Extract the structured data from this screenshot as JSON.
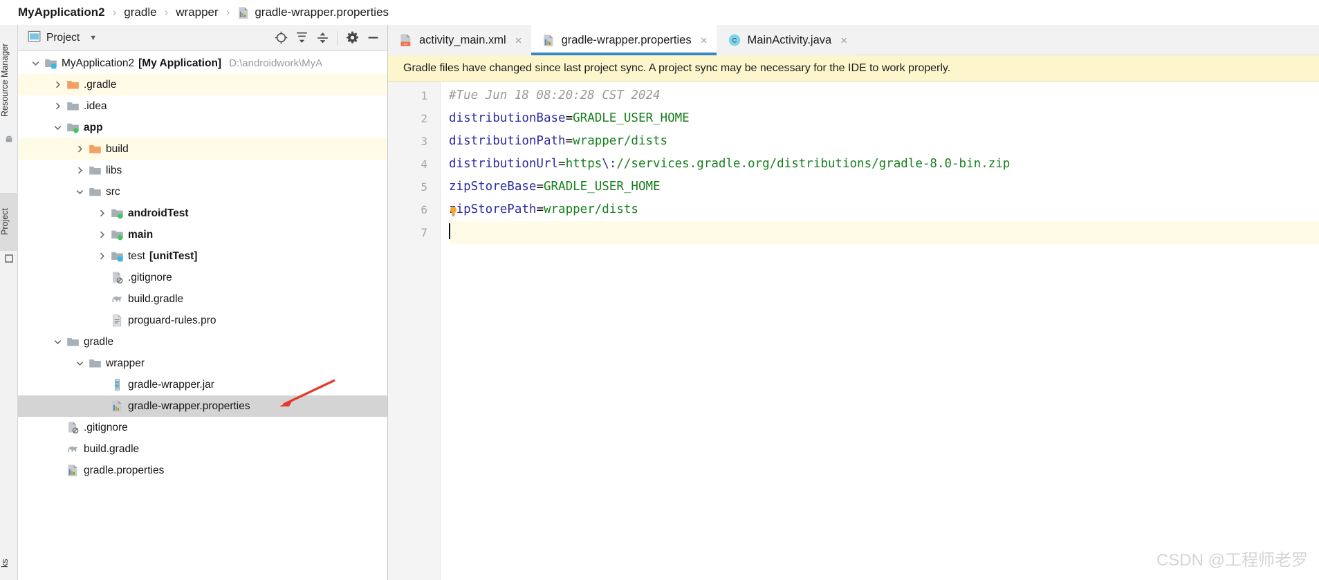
{
  "breadcrumb": {
    "items": [
      {
        "label": "MyApplication2",
        "bold": true,
        "icon": "none"
      },
      {
        "label": "gradle",
        "bold": false,
        "icon": "none"
      },
      {
        "label": "wrapper",
        "bold": false,
        "icon": "none"
      },
      {
        "label": "gradle-wrapper.properties",
        "bold": false,
        "icon": "properties-file-icon"
      }
    ],
    "separator": "›"
  },
  "tool_strip": {
    "tabs": [
      {
        "label": "Resource Manager",
        "selected": false
      },
      {
        "label": "Project",
        "selected": true
      },
      {
        "label": "ks",
        "selected": false
      }
    ]
  },
  "project_panel": {
    "title": "Project",
    "dropdown_caret": "▼",
    "toolbar_buttons": [
      {
        "name": "locate-in-tree-button",
        "glyph": "target-icon"
      },
      {
        "name": "expand-all-button",
        "glyph": "expand-all-icon"
      },
      {
        "name": "collapse-all-button",
        "glyph": "collapse-all-icon"
      },
      {
        "name": "settings-button",
        "glyph": "gear-icon"
      },
      {
        "name": "hide-button",
        "glyph": "minus-icon"
      }
    ],
    "tree": [
      {
        "indent": 0,
        "arrow": "down",
        "icon": "module-folder-blue",
        "label": "MyApplication2",
        "bold_suffix": "[My Application]",
        "path": "D:\\androidwork\\MyA",
        "row": "plain"
      },
      {
        "indent": 1,
        "arrow": "right",
        "icon": "folder-orange",
        "label": ".gradle",
        "row": "tint"
      },
      {
        "indent": 1,
        "arrow": "right",
        "icon": "folder-gray",
        "label": ".idea",
        "row": "plain"
      },
      {
        "indent": 1,
        "arrow": "down",
        "icon": "module-folder-green",
        "label": "app",
        "bold": true,
        "row": "plain"
      },
      {
        "indent": 2,
        "arrow": "right",
        "icon": "folder-orange",
        "label": "build",
        "row": "tint"
      },
      {
        "indent": 2,
        "arrow": "right",
        "icon": "folder-gray",
        "label": "libs",
        "row": "plain"
      },
      {
        "indent": 2,
        "arrow": "down",
        "icon": "folder-gray",
        "label": "src",
        "row": "plain"
      },
      {
        "indent": 3,
        "arrow": "right",
        "icon": "module-folder-green",
        "label": "androidTest",
        "bold": true,
        "row": "plain"
      },
      {
        "indent": 3,
        "arrow": "right",
        "icon": "module-folder-green",
        "label": "main",
        "bold": true,
        "row": "plain"
      },
      {
        "indent": 3,
        "arrow": "right",
        "icon": "module-folder-blue",
        "label": "test",
        "bold_suffix": "[unitTest]",
        "row": "plain"
      },
      {
        "indent": 3,
        "arrow": "none",
        "icon": "gitignore-file",
        "label": ".gitignore",
        "row": "plain"
      },
      {
        "indent": 3,
        "arrow": "none",
        "icon": "gradle-elephant",
        "label": "build.gradle",
        "row": "plain"
      },
      {
        "indent": 3,
        "arrow": "none",
        "icon": "text-file",
        "label": "proguard-rules.pro",
        "row": "plain"
      },
      {
        "indent": 1,
        "arrow": "down",
        "icon": "folder-gray",
        "label": "gradle",
        "row": "plain"
      },
      {
        "indent": 2,
        "arrow": "down",
        "icon": "folder-gray",
        "label": "wrapper",
        "row": "plain"
      },
      {
        "indent": 3,
        "arrow": "none",
        "icon": "jar-file",
        "label": "gradle-wrapper.jar",
        "row": "plain"
      },
      {
        "indent": 3,
        "arrow": "none",
        "icon": "properties-file-icon",
        "label": "gradle-wrapper.properties",
        "row": "selected"
      },
      {
        "indent": 1,
        "arrow": "none",
        "icon": "gitignore-file",
        "label": ".gitignore",
        "row": "plain"
      },
      {
        "indent": 1,
        "arrow": "none",
        "icon": "gradle-elephant",
        "label": "build.gradle",
        "row": "plain"
      },
      {
        "indent": 1,
        "arrow": "none",
        "icon": "properties-file-icon",
        "label": "gradle.properties",
        "row": "plain"
      }
    ]
  },
  "editor_tabs": [
    {
      "label": "activity_main.xml",
      "icon": "xml-layout-icon",
      "active": false,
      "close": "×"
    },
    {
      "label": "gradle-wrapper.properties",
      "icon": "properties-file-icon",
      "active": true,
      "close": "×"
    },
    {
      "label": "MainActivity.java",
      "icon": "java-class-icon",
      "active": false,
      "close": "×"
    }
  ],
  "notification": {
    "text": "Gradle files have changed since last project sync. A project sync may be necessary for the IDE to work properly.",
    "background": "#fdf6cd"
  },
  "editor": {
    "line_numbers": [
      "1",
      "2",
      "3",
      "4",
      "5",
      "6",
      "7"
    ],
    "lines": [
      {
        "n": 1,
        "tokens": [
          {
            "t": "comment",
            "s": "#Tue Jun 18 08:20:28 CST 2024"
          }
        ]
      },
      {
        "n": 2,
        "tokens": [
          {
            "t": "key",
            "s": "distributionBase"
          },
          {
            "t": "op",
            "s": "="
          },
          {
            "t": "value",
            "s": "GRADLE_USER_HOME"
          }
        ]
      },
      {
        "n": 3,
        "tokens": [
          {
            "t": "key",
            "s": "distributionPath"
          },
          {
            "t": "op",
            "s": "="
          },
          {
            "t": "value",
            "s": "wrapper/dists"
          }
        ]
      },
      {
        "n": 4,
        "tokens": [
          {
            "t": "key",
            "s": "distributionUrl"
          },
          {
            "t": "op",
            "s": "="
          },
          {
            "t": "value",
            "s": "https"
          },
          {
            "t": "escape",
            "s": "\\:"
          },
          {
            "t": "value",
            "s": "//services.gradle.org/distributions/gradle-8.0-bin.zip"
          }
        ]
      },
      {
        "n": 5,
        "tokens": [
          {
            "t": "key",
            "s": "zipStoreBase"
          },
          {
            "t": "op",
            "s": "="
          },
          {
            "t": "value",
            "s": "GRADLE_USER_HOME"
          }
        ]
      },
      {
        "n": 6,
        "tokens": [
          {
            "t": "key",
            "s": "zipStorePath"
          },
          {
            "t": "op",
            "s": "="
          },
          {
            "t": "value",
            "s": "wrapper/dists"
          }
        ],
        "bulb": true
      },
      {
        "n": 7,
        "tokens": [],
        "caret": true
      }
    ],
    "colors": {
      "key": "#2a2aa5",
      "value": "#177e1d",
      "comment": "#9a9a9a",
      "escape": "#2a2aa5",
      "cursor_line": "#fffbe6"
    }
  },
  "watermark": {
    "text": "CSDN @工程师老罗"
  },
  "annotation": {
    "type": "red-arrow",
    "color": "#e8382c"
  }
}
